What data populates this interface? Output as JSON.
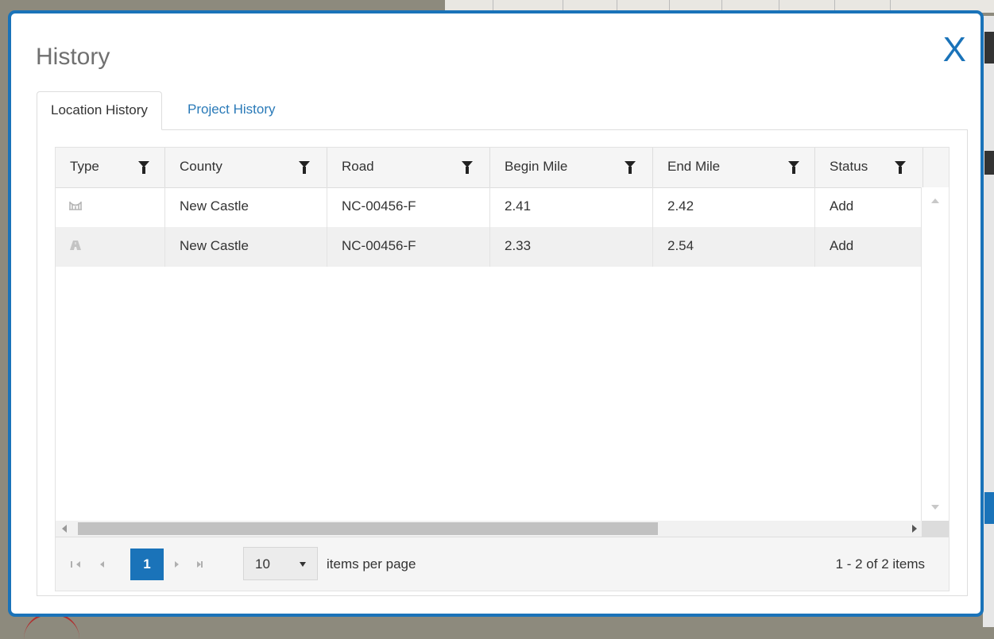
{
  "dialog": {
    "title": "History",
    "close_label": "X"
  },
  "tabs": [
    {
      "label": "Location History",
      "active": true
    },
    {
      "label": "Project History",
      "active": false
    }
  ],
  "grid": {
    "columns": [
      "Type",
      "County",
      "Road",
      "Begin Mile",
      "End Mile",
      "Status"
    ],
    "rows": [
      {
        "type_icon": "bridge-icon",
        "county": "New Castle",
        "road": "NC-00456-F",
        "begin_mile": "2.41",
        "end_mile": "2.42",
        "status": "Add"
      },
      {
        "type_icon": "road-icon",
        "county": "New Castle",
        "road": "NC-00456-F",
        "begin_mile": "2.33",
        "end_mile": "2.54",
        "status": "Add"
      }
    ]
  },
  "pager": {
    "current_page": "1",
    "page_size": "10",
    "page_size_label": "items per page",
    "info": "1 - 2 of 2 items"
  },
  "colors": {
    "accent": "#1a73b9",
    "link": "#2a7ab8",
    "header_bg": "#f5f5f5"
  }
}
